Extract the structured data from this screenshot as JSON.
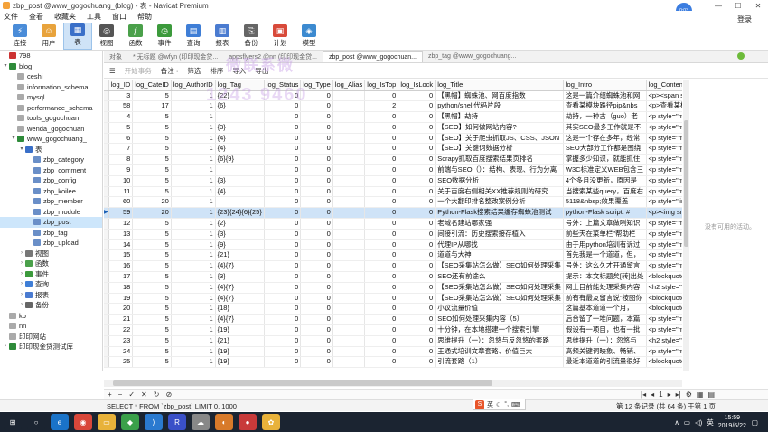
{
  "window": {
    "title": "zbp_post @www_gogochuang_(blog) - 表 - Navicat Premium",
    "user_badge": "0:03",
    "login": "登录"
  },
  "menu": [
    "文件",
    "查看",
    "收藏夹",
    "工具",
    "窗口",
    "帮助"
  ],
  "toolbar": [
    {
      "label": "连接",
      "color": "#4a8cd8",
      "glyph": "⚡"
    },
    {
      "label": "用户",
      "color": "#e8a33c",
      "glyph": "☺"
    },
    {
      "label": "表",
      "color": "#3a6fc8",
      "glyph": "▦",
      "active": true
    },
    {
      "label": "视图",
      "color": "#555",
      "glyph": "◎"
    },
    {
      "label": "函数",
      "color": "#4aa04a",
      "glyph": "ƒ"
    },
    {
      "label": "事件",
      "color": "#3c9a3c",
      "glyph": "◷"
    },
    {
      "label": "查询",
      "color": "#3f7ed6",
      "glyph": "▤"
    },
    {
      "label": "报表",
      "color": "#4a7bd0",
      "glyph": "▥"
    },
    {
      "label": "备份",
      "color": "#666",
      "glyph": "⎘"
    },
    {
      "label": "计划",
      "color": "#d84a3a",
      "glyph": "▣"
    },
    {
      "label": "模型",
      "color": "#3c8ad0",
      "glyph": "◈"
    }
  ],
  "sidebar": [
    {
      "label": "798",
      "level": 0,
      "arrow": "",
      "color": "#cc3333"
    },
    {
      "label": "blog",
      "level": 0,
      "arrow": "▾",
      "color": "#2e8b3a"
    },
    {
      "label": "ceshi",
      "level": 1,
      "arrow": "",
      "color": "#aaa"
    },
    {
      "label": "information_schema",
      "level": 1,
      "arrow": "",
      "color": "#aaa"
    },
    {
      "label": "mysql",
      "level": 1,
      "arrow": "",
      "color": "#aaa"
    },
    {
      "label": "performance_schema",
      "level": 1,
      "arrow": "",
      "color": "#aaa"
    },
    {
      "label": "tools_gogochuan",
      "level": 1,
      "arrow": "",
      "color": "#aaa"
    },
    {
      "label": "wenda_gogochuan",
      "level": 1,
      "arrow": "",
      "color": "#aaa"
    },
    {
      "label": "www_gogochuang_",
      "level": 1,
      "arrow": "▾",
      "color": "#2e8b3a"
    },
    {
      "label": "表",
      "level": 2,
      "arrow": "▾",
      "color": "#3a6fc8"
    },
    {
      "label": "zbp_category",
      "level": 3,
      "arrow": "",
      "color": "#6a8fc8"
    },
    {
      "label": "zbp_comment",
      "level": 3,
      "arrow": "",
      "color": "#6a8fc8"
    },
    {
      "label": "zbp_config",
      "level": 3,
      "arrow": "",
      "color": "#6a8fc8"
    },
    {
      "label": "zbp_koilee",
      "level": 3,
      "arrow": "",
      "color": "#6a8fc8"
    },
    {
      "label": "zbp_member",
      "level": 3,
      "arrow": "",
      "color": "#6a8fc8"
    },
    {
      "label": "zbp_module",
      "level": 3,
      "arrow": "",
      "color": "#6a8fc8"
    },
    {
      "label": "zbp_post",
      "level": 3,
      "arrow": "",
      "color": "#6a8fc8",
      "selected": true
    },
    {
      "label": "zbp_tag",
      "level": 3,
      "arrow": "",
      "color": "#6a8fc8"
    },
    {
      "label": "zbp_upload",
      "level": 3,
      "arrow": "",
      "color": "#6a8fc8"
    },
    {
      "label": "视图",
      "level": 2,
      "arrow": "›",
      "color": "#777"
    },
    {
      "label": "函数",
      "level": 2,
      "arrow": "›",
      "color": "#4aa04a"
    },
    {
      "label": "事件",
      "level": 2,
      "arrow": "›",
      "color": "#3c9a3c"
    },
    {
      "label": "查询",
      "level": 2,
      "arrow": "›",
      "color": "#3f7ed6"
    },
    {
      "label": "报表",
      "level": 2,
      "arrow": "›",
      "color": "#4a7bd0"
    },
    {
      "label": "备份",
      "level": 2,
      "arrow": "›",
      "color": "#666"
    },
    {
      "label": "kp",
      "level": 0,
      "arrow": "",
      "color": "#aaa"
    },
    {
      "label": "nn",
      "level": 0,
      "arrow": "",
      "color": "#aaa"
    },
    {
      "label": "印印网站",
      "level": 0,
      "arrow": "",
      "color": "#aaa"
    },
    {
      "label": "印印现金贷测试库",
      "level": 0,
      "arrow": "›",
      "color": "#2e8b3a"
    }
  ],
  "tabs": [
    {
      "label": "对象"
    },
    {
      "label": "* 无标题 @wfyn (印印现金贷..."
    },
    {
      "label": "appsflyers2 @nn (印印现金贷..."
    },
    {
      "label": "zbp_post @www_gogochuan...",
      "active": true
    },
    {
      "label": "zbp_tag @www_gogochuang..."
    }
  ],
  "subtoolbar": [
    {
      "label": "开始事务",
      "dim": true
    },
    {
      "label": "备注 ·",
      "dim": false
    },
    {
      "label": "筛选",
      "dim": false
    },
    {
      "label": "排序",
      "dim": false
    },
    {
      "label": "导入",
      "dim": false
    },
    {
      "label": "导出",
      "dim": false
    }
  ],
  "watermark": {
    "line1": "微联系微",
    "line2": "1243 9460"
  },
  "columns": [
    "log_ID",
    "log_CateID",
    "log_AuthorID",
    "log_Tag",
    "log_Status",
    "log_Type",
    "log_Alias",
    "log_IsTop",
    "log_IsLock",
    "log_Title",
    "log_Intro",
    "log_Content"
  ],
  "rows": [
    [
      "3",
      "5",
      "1",
      "{22}",
      "0",
      "0",
      "",
      "0",
      "0",
      "【黑帽】蜘蛛池、网百度指数",
      "这是一篇介绍蜘蛛池和网",
      "<p><span sty"
    ],
    [
      "58",
      "17",
      "1",
      "{6}",
      "0",
      "0",
      "",
      "2",
      "0",
      "python/shell代码片段",
      "查看某模块路径pip&nbs",
      "<p>查看某模块"
    ],
    [
      "4",
      "5",
      "1",
      "",
      "0",
      "0",
      "",
      "0",
      "0",
      "【黑帽】劫持",
      "劫持，一种古（guo）老",
      "<p style=\"ma"
    ],
    [
      "5",
      "5",
      "1",
      "{3}",
      "0",
      "0",
      "",
      "0",
      "0",
      "【SEO】如何做网站内容?",
      "其实SEO最多工作就是不",
      "<p style=\"ma"
    ],
    [
      "6",
      "5",
      "1",
      "{4}",
      "0",
      "0",
      "",
      "0",
      "0",
      "【SEO】关于爬虫抓取JS、CSS、JSON",
      "这是一个存在多年，经常",
      "<p style=\"ma"
    ],
    [
      "7",
      "5",
      "1",
      "{4}",
      "0",
      "0",
      "",
      "0",
      "0",
      "【SEO】关键词数据分析",
      "SEO大部分工作都是围绕",
      "<p style=\"ma"
    ],
    [
      "8",
      "5",
      "1",
      "{6}{9}",
      "0",
      "0",
      "",
      "0",
      "0",
      "Scrapy抓取百度搜索结果页排名",
      "掌握多少知识，就能抓住",
      "<p style=\"ma"
    ],
    [
      "9",
      "5",
      "1",
      "",
      "0",
      "0",
      "",
      "0",
      "0",
      "前端与SEO（）：结构、表现、行为分离",
      "W3C标准定义WEB包含三",
      "<p style=\"ma"
    ],
    [
      "10",
      "5",
      "1",
      "{3}",
      "0",
      "0",
      "",
      "0",
      "0",
      "SEO数据分析",
      "4个多月没更新，原因是",
      "<p style=\"ma"
    ],
    [
      "11",
      "5",
      "1",
      "{4}",
      "0",
      "0",
      "",
      "0",
      "0",
      "关于百度右侧相关XX推荐规则的研究",
      "当搜索某些query，百度右",
      "<p style=\"ma"
    ],
    [
      "60",
      "20",
      "1",
      "",
      "0",
      "0",
      "",
      "0",
      "0",
      "一个大翻印排名整改案例分析",
      "5118&nbsp;效果覆盖",
      "<p style=\"line"
    ],
    [
      "59",
      "20",
      "1",
      "{23}{24}{6}{25}",
      "0",
      "0",
      "",
      "0",
      "0",
      "Python-Flask搜索结果缓存蜘蛛池测试",
      "python-Flask script: #",
      "<p><img src="
    ],
    [
      "12",
      "5",
      "1",
      "{2}",
      "0",
      "0",
      "",
      "0",
      "0",
      "老域名建站哪家强",
      "号外：上篇文章做咧知识",
      "<p style=\"ma"
    ],
    [
      "13",
      "5",
      "1",
      "{3}",
      "0",
      "0",
      "",
      "0",
      "0",
      "间接引流：历史搜索接存植入",
      "前些天在菜单栏\"帮助栏",
      "<p style=\"ma"
    ],
    [
      "14",
      "5",
      "1",
      "{9}",
      "0",
      "0",
      "",
      "0",
      "0",
      "代理IP从哪找",
      "由于用python培训有诉过",
      "<p style=\"ma"
    ],
    [
      "15",
      "5",
      "1",
      "{21}",
      "0",
      "0",
      "",
      "0",
      "0",
      "道道与大神",
      "首先我是一个道道，但，",
      "<p style=\"ma"
    ],
    [
      "16",
      "5",
      "1",
      "{4}{7}",
      "0",
      "0",
      "",
      "0",
      "0",
      "【SEO采集站怎么做】SEO如何处理采集",
      "号外：这么久才开通留言",
      "<p style=\"ma"
    ],
    [
      "17",
      "5",
      "1",
      "{3}",
      "0",
      "0",
      "",
      "0",
      "0",
      "SEO还有前途么",
      "提示：本文标题矣[转]出处",
      "<blockquote s"
    ],
    [
      "18",
      "5",
      "1",
      "{4}{7}",
      "0",
      "0",
      "",
      "0",
      "0",
      "【SEO采集站怎么做】SEO如何处理采集",
      "网上目前能处理采集内容",
      "<h2 style=\"m"
    ],
    [
      "19",
      "5",
      "1",
      "{4}{7}",
      "0",
      "0",
      "",
      "0",
      "0",
      "【SEO采集站怎么做】SEO如何处理采集",
      "前有有最友留言说\"按图你",
      "<blockquote s"
    ],
    [
      "20",
      "5",
      "1",
      "{18}",
      "0",
      "0",
      "",
      "0",
      "0",
      "小议流量价值",
      "这篇基本道道一个月，",
      "<blockquote s"
    ],
    [
      "21",
      "5",
      "1",
      "{4}{7}",
      "0",
      "0",
      "",
      "0",
      "0",
      "SEO如何处理采集内容（5）",
      "后台留了一堆问题，本篇",
      "<p style=\"ma"
    ],
    [
      "22",
      "5",
      "1",
      "{19}",
      "0",
      "0",
      "",
      "0",
      "0",
      "十分钟，在本地搭建一个搜索引擎",
      "假设有一项目，也有一批",
      "<p style=\"ma"
    ],
    [
      "23",
      "5",
      "1",
      "{21}",
      "0",
      "0",
      "",
      "0",
      "0",
      "思维提升（一）：忽悠与反忽悠的套路",
      "思维提升（一）：忽悠与",
      "<h2 style=\"m"
    ],
    [
      "24",
      "5",
      "1",
      "{19}",
      "0",
      "0",
      "",
      "0",
      "0",
      "王通式培训文章套路、价值巨大",
      "高频关键词映象、畅销、",
      "<p style=\"ma"
    ],
    [
      "25",
      "5",
      "1",
      "{19}",
      "0",
      "0",
      "",
      "0",
      "0",
      "引流套路（1）",
      "最近本道道的引流量很好",
      "<blockquote s"
    ]
  ],
  "selected_row": 11,
  "right_panel_msg": "没有可用的活动。",
  "navbar": {
    "left": [
      "+",
      "−",
      "✓",
      "✕",
      "↻",
      "⊘"
    ],
    "page": "1"
  },
  "status": {
    "sql": "SELECT * FROM `zbp_post` LIMIT 0, 1000",
    "records": "第 12 条记录 (共 64 条) 于第 1 页"
  },
  "ime": {
    "label": "S",
    "lang": "英"
  },
  "taskbar": [
    {
      "name": "start",
      "glyph": "⊞",
      "color": "#1b2431"
    },
    {
      "name": "search",
      "glyph": "○",
      "color": "#1b2431"
    },
    {
      "name": "edge",
      "glyph": "e",
      "color": "#1a73c8"
    },
    {
      "name": "chrome",
      "glyph": "◉",
      "color": "#d9473a"
    },
    {
      "name": "explorer",
      "glyph": "▭",
      "color": "#e8b23a"
    },
    {
      "name": "app-green",
      "glyph": "◆",
      "color": "#3aa04a"
    },
    {
      "name": "vscode",
      "glyph": "⟩",
      "color": "#2a7ad0"
    },
    {
      "name": "app-rdo",
      "glyph": "R",
      "color": "#3a50c8"
    },
    {
      "name": "app-cloud",
      "glyph": "☁",
      "color": "#888"
    },
    {
      "name": "app-orange",
      "glyph": "◐",
      "color": "#d87a2a"
    },
    {
      "name": "app-red",
      "glyph": "●",
      "color": "#c83a3a"
    },
    {
      "name": "navicat",
      "glyph": "✿",
      "color": "#e8b23a"
    }
  ],
  "tray": {
    "lang": "英",
    "time": "15:59",
    "date": "2019/6/22"
  }
}
